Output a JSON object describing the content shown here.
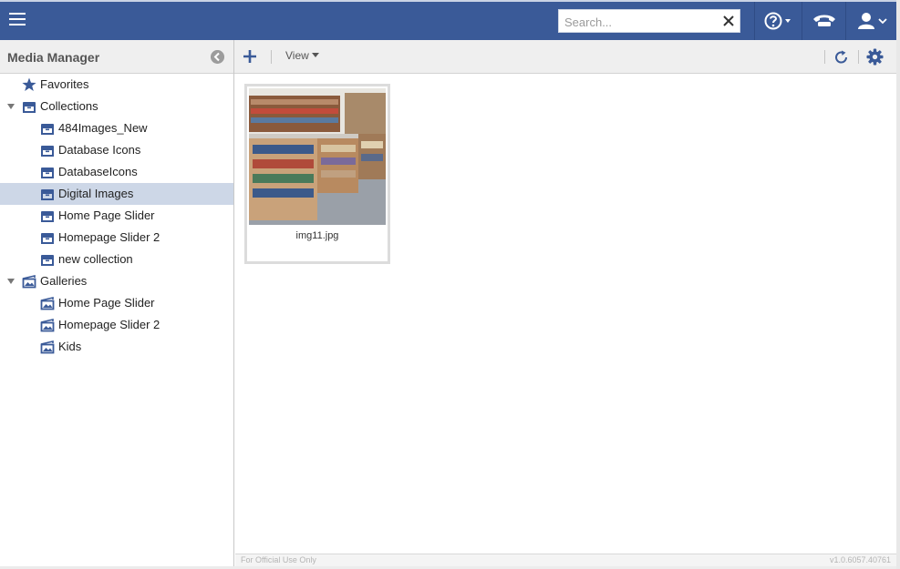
{
  "app": {
    "title": "Media Manager",
    "accent": "#3a5a98",
    "selected_bg": "#cdd7e7",
    "icon_color": "#3a5a98"
  },
  "topbar": {
    "menu_icon": "hamburger-icon",
    "search": {
      "value": "",
      "placeholder": "Search..."
    },
    "help_icon": "help-circle-icon",
    "phone_icon": "telephone-icon",
    "user_icon": "user-icon"
  },
  "sidebar": {
    "collapse_icon": "chevron-left-circle-icon",
    "favorites": {
      "label": "Favorites",
      "icon": "star-icon"
    },
    "collections": {
      "label": "Collections",
      "icon": "collection-box-icon",
      "items": [
        {
          "label": "484Images_New",
          "selected": false
        },
        {
          "label": "Database Icons",
          "selected": false
        },
        {
          "label": "DatabaseIcons",
          "selected": false
        },
        {
          "label": "Digital Images",
          "selected": true
        },
        {
          "label": "Home Page Slider",
          "selected": false
        },
        {
          "label": "Homepage Slider 2",
          "selected": false
        },
        {
          "label": "new collection",
          "selected": false
        }
      ]
    },
    "galleries": {
      "label": "Galleries",
      "icon": "gallery-icon",
      "items": [
        {
          "label": "Home Page Slider"
        },
        {
          "label": "Homepage Slider 2"
        },
        {
          "label": "Kids"
        }
      ]
    }
  },
  "toolbar": {
    "add_icon": "plus-icon",
    "view_label": "View",
    "refresh_icon": "refresh-icon",
    "settings_icon": "gear-icon"
  },
  "content": {
    "files": [
      {
        "name": "img11.jpg",
        "image": "library-bookshelves-photo"
      }
    ]
  },
  "footer": {
    "left": "For Official Use Only",
    "right": "v1.0.6057.40761"
  }
}
